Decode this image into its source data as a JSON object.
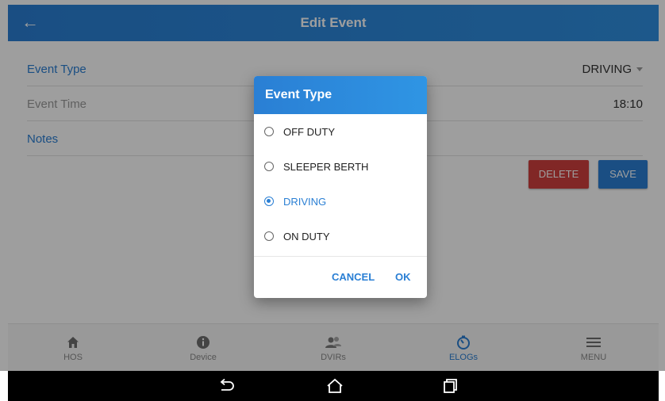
{
  "appbar": {
    "title": "Edit Event",
    "back_icon": "arrow-left-icon"
  },
  "form": {
    "event_type": {
      "label": "Event Type",
      "value": "DRIVING"
    },
    "event_time": {
      "label": "Event Time",
      "value": "18:10"
    },
    "notes": {
      "label": "Notes"
    }
  },
  "actions": {
    "delete_label": "DELETE",
    "save_label": "SAVE"
  },
  "dialog": {
    "title": "Event Type",
    "options": [
      {
        "label": "OFF DUTY",
        "selected": false
      },
      {
        "label": "SLEEPER BERTH",
        "selected": false
      },
      {
        "label": "DRIVING",
        "selected": true
      },
      {
        "label": "ON DUTY",
        "selected": false
      }
    ],
    "cancel_label": "CANCEL",
    "ok_label": "OK"
  },
  "bottom_nav": {
    "items": [
      {
        "label": "HOS",
        "icon": "home-icon"
      },
      {
        "label": "Device",
        "icon": "info-icon"
      },
      {
        "label": "DVIRs",
        "icon": "people-icon"
      },
      {
        "label": "ELOGs",
        "icon": "timer-icon",
        "active": true
      },
      {
        "label": "MENU",
        "icon": "menu-icon"
      }
    ]
  },
  "system_nav": {
    "back": "system-back-icon",
    "home": "system-home-icon",
    "recents": "system-recents-icon"
  },
  "colors": {
    "accent": "#2a7fd4",
    "delete": "#d0403e"
  }
}
